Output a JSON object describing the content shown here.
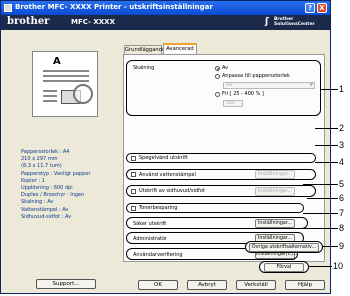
{
  "window": {
    "title": "Brother MFC- XXXX   Printer - utskriftsinställningar",
    "help_btn": "?",
    "close_btn": "X"
  },
  "brand": {
    "logo": "brother",
    "model": "MFC- XXXX",
    "solutions_line1": "Brother",
    "solutions_line2": "SolutionsCenter"
  },
  "tabs": [
    {
      "label": "Grundläggande"
    },
    {
      "label": "Avancerad"
    }
  ],
  "info": [
    "Pappersstorlek : A4",
    "210 x 297 mm",
    "(8.3 x 11.7 tum)",
    "Papperstyp : Vanligt papper",
    "Kopior : 1",
    "Upplösning : 600 dpi",
    "Duplex / Broschyr : Ingen",
    "Skalning : Av",
    "Vattenstämpel : Av",
    "Sidhuvud-sidfot : Av"
  ],
  "support_label": "Support...",
  "scaling": {
    "label": "Skalning",
    "opt_off": "Av",
    "opt_fit": "Anpassa till pappersstorlek",
    "size_value": "A4",
    "opt_free": "Fri [ 25 - 400 % ]",
    "free_value": "100"
  },
  "reverse": {
    "label": "Spegelvänd utskrift"
  },
  "watermark": {
    "label": "Använd vattenstämpel",
    "button": "Inställningar..."
  },
  "header_footer": {
    "label": "Utskrift av sidhuvud/sidfot",
    "button": "Inställningar..."
  },
  "toner_save": {
    "label": "Tonerbesparing"
  },
  "secure": {
    "label": "Säker utskrift",
    "button": "Inställningar..."
  },
  "admin": {
    "label": "Administratör",
    "button": "Inställningar..."
  },
  "user_auth": {
    "label": "Användarverifiering",
    "button": "Inställningar(C)..."
  },
  "other_btn": "Övriga utskriftsalternativ...",
  "default_btn": "Förval",
  "footer": {
    "ok": "OK",
    "cancel": "Avbryt",
    "apply": "Verkställ",
    "help": "Hjälp"
  },
  "callouts": [
    "1",
    "2",
    "3",
    "4",
    "5",
    "6",
    "7",
    "8",
    "9",
    "10"
  ]
}
